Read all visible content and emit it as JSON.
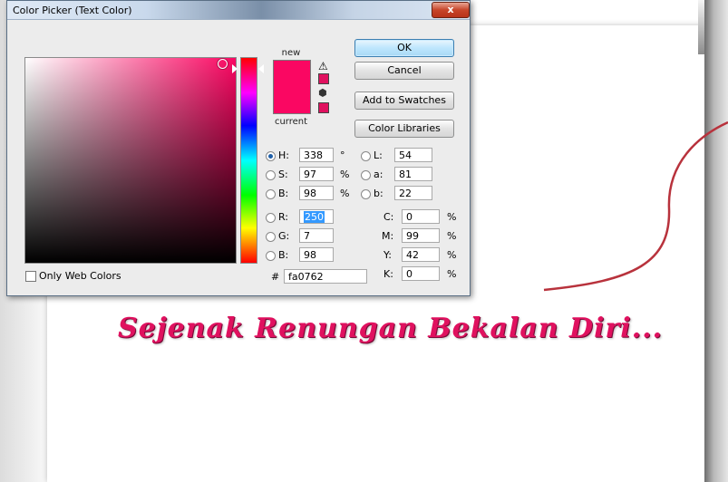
{
  "dialog": {
    "title": "Color Picker (Text Color)",
    "close_label": "x",
    "new_label": "new",
    "current_label": "current",
    "new_color": "#fa0762",
    "current_color": "#fa0762",
    "buttons": {
      "ok": "OK",
      "cancel": "Cancel",
      "add_to_swatches": "Add to Swatches",
      "color_libraries": "Color Libraries"
    },
    "hsb": {
      "h_label": "H:",
      "h_value": "338",
      "h_unit": "°",
      "s_label": "S:",
      "s_value": "97",
      "s_unit": "%",
      "b_label": "B:",
      "b_value": "98",
      "b_unit": "%"
    },
    "rgb": {
      "r_label": "R:",
      "r_value": "250",
      "g_label": "G:",
      "g_value": "7",
      "b_label": "B:",
      "b_value": "98"
    },
    "lab": {
      "l_label": "L:",
      "l_value": "54",
      "a_label": "a:",
      "a_value": "81",
      "b_label": "b:",
      "b_value": "22"
    },
    "cmyk": {
      "c_label": "C:",
      "c_value": "0",
      "c_unit": "%",
      "m_label": "M:",
      "m_value": "99",
      "m_unit": "%",
      "y_label": "Y:",
      "y_value": "42",
      "y_unit": "%",
      "k_label": "K:",
      "k_value": "0",
      "k_unit": "%"
    },
    "hex_label": "#",
    "hex_value": "fa0762",
    "only_web_colors_label": "Only Web Colors",
    "only_web_colors_checked": false,
    "selected_mode": "H",
    "icons": {
      "gamut_warning": "warning-icon",
      "web_safe": "cube-icon"
    }
  },
  "canvas": {
    "tagline": "Sejenak Renungan Bekalan Diri...",
    "tagline_color": "#e0115f",
    "curve_color": "#b8323c"
  }
}
